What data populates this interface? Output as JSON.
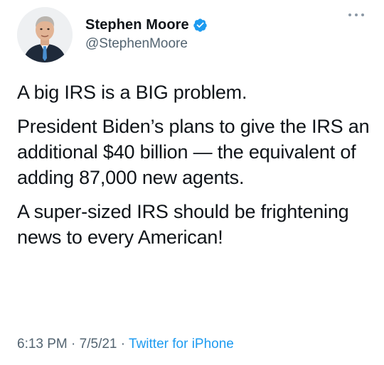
{
  "tweet": {
    "author": {
      "display_name": "Stephen Moore",
      "handle": "@StephenMoore",
      "verified_icon": "verified-badge-icon",
      "avatar_icon": "profile-photo"
    },
    "more_icon": "more-options-icon",
    "paragraphs": [
      "A big IRS is a BIG problem.",
      "President Biden’s plans to give the IRS an additional $40 billion — the equivalent of adding 87,000 new agents.",
      "A super-sized IRS should be frightening news to every American!"
    ],
    "meta": {
      "time": "6:13 PM",
      "separator": " · ",
      "date": "7/5/21",
      "source": "Twitter for iPhone"
    }
  },
  "colors": {
    "text": "#0f1419",
    "secondary": "#536471",
    "accent": "#1d9bf0"
  }
}
